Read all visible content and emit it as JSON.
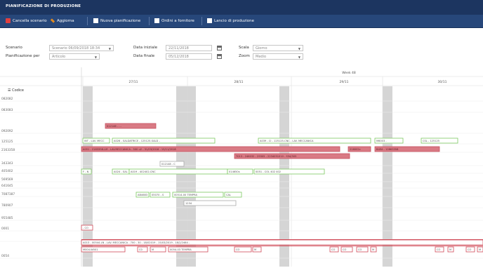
{
  "window": {
    "title": "PIANIFICAZIONE DI PRODUZIONE"
  },
  "toolbar": {
    "buttons": [
      {
        "label": "Cancella scenario",
        "icon": "delete-icon",
        "color": "#e04040"
      },
      {
        "label": "Aggiorna",
        "icon": "wrench-icon",
        "color": "#e08a20"
      },
      {
        "label": "Nuova pianificazione",
        "icon": "document-icon",
        "color": "#ffffff"
      },
      {
        "label": "Ordini a fornitore",
        "icon": "document-icon",
        "color": "#ffffff"
      },
      {
        "label": "Lancio di produzione",
        "icon": "document-icon",
        "color": "#ffffff"
      }
    ]
  },
  "form": {
    "scenario_label": "Scenario",
    "scenario_value": "Scenario 06/09/2018 18:34",
    "pianificazione_label": "Pianificazione per",
    "pianificazione_value": "Articolo",
    "data_iniziale_label": "Data iniziale",
    "data_iniziale_value": "22/11/2018",
    "data_finale_label": "Data finale",
    "data_finale_value": "05/12/2018",
    "scala_label": "Scala",
    "scala_value": "Giorno",
    "zoom_label": "Zoom",
    "zoom_value": "Medio"
  },
  "gantt": {
    "codice_header": "Codice",
    "week_label": "Week 48",
    "days": [
      "27/11",
      "28/11",
      "29/11",
      "30/11"
    ],
    "rows": [
      "082082",
      "083083",
      "092092",
      "125125",
      "2163358",
      "343343",
      "405402",
      "569569",
      "641645",
      "7087387",
      "780907",
      "955485",
      "0001",
      "",
      "0054"
    ],
    "bars": [
      {
        "text": "012146 - ...",
        "color": "red"
      },
      {
        "text": "INT - LAV. MECC",
        "color": "green"
      },
      {
        "text": "A026 - SALDATRICE - 125125-SALD -",
        "color": "green"
      },
      {
        "text": "A039 - CI - 125125-CNC - LAV. MECCANICA",
        "color": "green"
      },
      {
        "text": "M6003 -",
        "color": "green"
      },
      {
        "text": "CSL - 125125",
        "color": "green"
      },
      {
        "text": "A051 - 2163358-LM - LAV.MECCANICA - 500 u2 - 31/03/2018 - 15/11/2018",
        "color": "red"
      },
      {
        "text": "216002c",
        "color": "red"
      },
      {
        "text": "B4EA - 12863358",
        "color": "red"
      },
      {
        "text": "7013 - 246032 - 29305 - 2234051010 - S34/305",
        "color": "red"
      },
      {
        "text": "012148 - C",
        "color": "grey"
      },
      {
        "text": "F - N",
        "color": "green"
      },
      {
        "text": "A024 - SALDA",
        "color": "green"
      },
      {
        "text": "A019 - 402402-CNC",
        "color": "green"
      },
      {
        "text": "014650s",
        "color": "green"
      },
      {
        "text": "0051 - COL 402 402",
        "color": "green"
      },
      {
        "text": "AB4683 - 6",
        "color": "green"
      },
      {
        "text": "05070 - S",
        "color": "green"
      },
      {
        "text": "00514-00 TEMPRA",
        "color": "green"
      },
      {
        "text": "CAL",
        "color": "green"
      },
      {
        "text": "1234",
        "color": "grey"
      },
      {
        "text": "- CO",
        "color": "pink"
      },
      {
        "text": "A013 - 00544-LN - LAV. MECCANICA - 700 - 30 - 18/02019 - 15/03/2019 - 18/2/2464 -",
        "color": "pink"
      },
      {
        "text": "M004-W001",
        "color": "pink"
      },
      {
        "text": "C0",
        "color": "pink"
      },
      {
        "text": "M",
        "color": "pink"
      },
      {
        "text": "0054-03 TEMPRA",
        "color": "pink"
      },
      {
        "text": "CO",
        "color": "pink"
      },
      {
        "text": "M",
        "color": "pink"
      },
      {
        "text": "CO",
        "color": "pink"
      },
      {
        "text": "CO",
        "color": "pink"
      },
      {
        "text": "CO",
        "color": "pink"
      },
      {
        "text": "M",
        "color": "pink"
      },
      {
        "text": "CO",
        "color": "pink"
      },
      {
        "text": "M",
        "color": "pink"
      },
      {
        "text": "CO",
        "color": "pink"
      },
      {
        "text": "M",
        "color": "pink"
      }
    ]
  },
  "colors": {
    "titlebar": "#1c3560",
    "toolbar": "#27477a",
    "bar_green": "#7cc860",
    "bar_red": "#d97a84",
    "bar_pink": "#d04a57"
  }
}
